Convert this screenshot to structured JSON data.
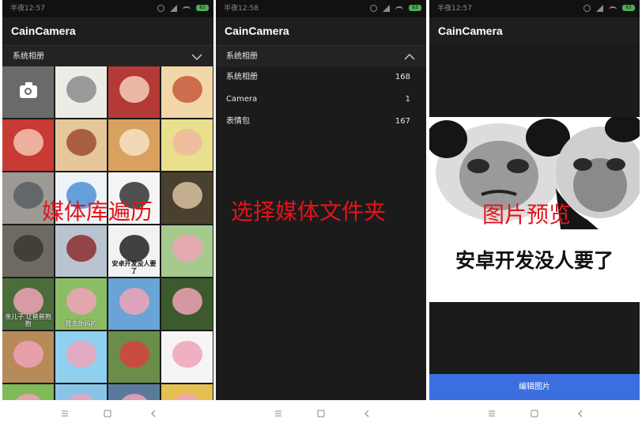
{
  "colors": {
    "overlay": "#e3141a",
    "button": "#3b6fe0",
    "battery": "#4caf50"
  },
  "panels": [
    {
      "status_time": "半夜12:57",
      "battery": "63",
      "app_title": "CainCamera",
      "album_dropdown": "系统相册",
      "dropdown_state": "collapsed",
      "overlay_label": "媒体库遍历",
      "camera_icon": "camera-icon"
    },
    {
      "status_time": "半夜12:58",
      "battery": "63",
      "app_title": "CainCamera",
      "album_dropdown": "系统相册",
      "dropdown_state": "expanded",
      "overlay_label": "选择媒体文件夹",
      "folders": [
        {
          "name": "系统相册",
          "count": "168"
        },
        {
          "name": "Camera",
          "count": "1"
        },
        {
          "name": "表情包",
          "count": "167"
        }
      ]
    },
    {
      "status_time": "半夜12:57",
      "battery": "63",
      "app_title": "CainCamera",
      "overlay_label": "图片预览",
      "image_caption": "安卓开发没人要了",
      "edit_button": "编辑图片"
    }
  ],
  "thumbnails": [
    {
      "text": "",
      "bg": "#6a6a6a",
      "accent": "#ffffff"
    },
    {
      "text": "",
      "bg": "#ecebe6",
      "accent": "#8c8c8c"
    },
    {
      "text": "",
      "bg": "#b33a35",
      "accent": "#f3cfb8"
    },
    {
      "text": "",
      "bg": "#f2d7a8",
      "accent": "#c55a3d"
    },
    {
      "text": "",
      "bg": "#c73b34",
      "accent": "#f2c6b0"
    },
    {
      "text": "",
      "bg": "#e6c79a",
      "accent": "#9e4e32"
    },
    {
      "text": "",
      "bg": "#d9a15f",
      "accent": "#f6e3c4"
    },
    {
      "text": "",
      "bg": "#e8e08d",
      "accent": "#f0b9a0"
    },
    {
      "text": "",
      "bg": "#9d9a95",
      "accent": "#5b5e63"
    },
    {
      "text": "",
      "bg": "#eef3f8",
      "accent": "#4e8fd6"
    },
    {
      "text": "",
      "bg": "#f5f5f5",
      "accent": "#333333"
    },
    {
      "text": "",
      "bg": "#4a4030",
      "accent": "#d8c3a0"
    },
    {
      "text": "",
      "bg": "#6f6a61",
      "accent": "#3b3731"
    },
    {
      "text": "",
      "bg": "#b9c4d0",
      "accent": "#8b2e2e"
    },
    {
      "text": "安卓开发没人要了",
      "bg": "#f2f2f2",
      "accent": "#222222"
    },
    {
      "text": "",
      "bg": "#a6c98d",
      "accent": "#f0a3b8"
    },
    {
      "text": "亲儿子 让爸爸抱抱",
      "bg": "#4a6d3a",
      "accent": "#f0a3b8"
    },
    {
      "text": "我去你妈的",
      "bg": "#8bbd63",
      "accent": "#f0a3b8"
    },
    {
      "text": "",
      "bg": "#6aa3d6",
      "accent": "#f0a3b8"
    },
    {
      "text": "",
      "bg": "#3c5a2c",
      "accent": "#f0a3b8"
    },
    {
      "text": "",
      "bg": "#b78a5a",
      "accent": "#f0a3b8"
    },
    {
      "text": "",
      "bg": "#8fd0ee",
      "accent": "#f0a3b8"
    },
    {
      "text": "",
      "bg": "#6a8e4a",
      "accent": "#d7423d"
    },
    {
      "text": "",
      "bg": "#f5f5f5",
      "accent": "#f0a3b8"
    },
    {
      "text": "",
      "bg": "#7fb95a",
      "accent": "#f0a3b8"
    },
    {
      "text": "",
      "bg": "#89c4e8",
      "accent": "#f0a3b8"
    },
    {
      "text": "",
      "bg": "#5a7a9c",
      "accent": "#f0a3b8"
    },
    {
      "text": "",
      "bg": "#e3c050",
      "accent": "#f0a3b8"
    }
  ]
}
